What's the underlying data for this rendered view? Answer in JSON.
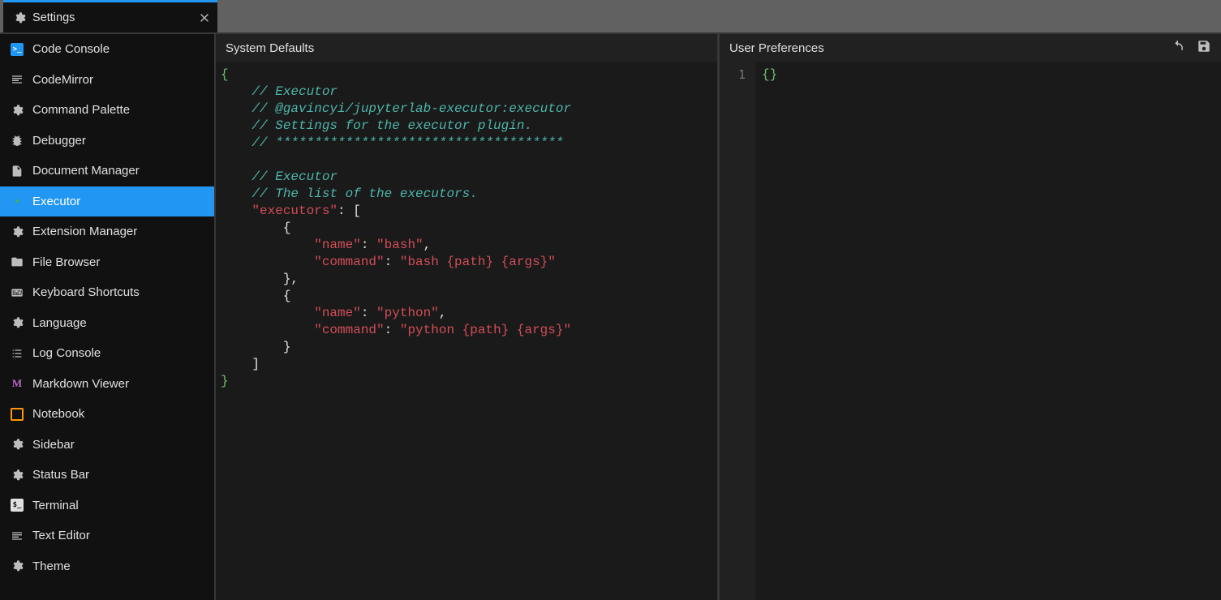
{
  "tab": {
    "title": "Settings"
  },
  "sidebar": {
    "items": [
      {
        "label": "Code Console",
        "icon": "console-icon",
        "selected": false
      },
      {
        "label": "CodeMirror",
        "icon": "lines-icon",
        "selected": false
      },
      {
        "label": "Command Palette",
        "icon": "gear-icon",
        "selected": false
      },
      {
        "label": "Debugger",
        "icon": "bug-icon",
        "selected": false
      },
      {
        "label": "Document Manager",
        "icon": "file-icon",
        "selected": false
      },
      {
        "label": "Executor",
        "icon": "play-icon",
        "selected": true
      },
      {
        "label": "Extension Manager",
        "icon": "gear-icon",
        "selected": false
      },
      {
        "label": "File Browser",
        "icon": "folder-icon",
        "selected": false
      },
      {
        "label": "Keyboard Shortcuts",
        "icon": "keyboard-icon",
        "selected": false
      },
      {
        "label": "Language",
        "icon": "gear-icon",
        "selected": false
      },
      {
        "label": "Log Console",
        "icon": "list-icon",
        "selected": false
      },
      {
        "label": "Markdown Viewer",
        "icon": "markdown-icon",
        "selected": false
      },
      {
        "label": "Notebook",
        "icon": "notebook-icon",
        "selected": false
      },
      {
        "label": "Sidebar",
        "icon": "gear-icon",
        "selected": false
      },
      {
        "label": "Status Bar",
        "icon": "gear-icon",
        "selected": false
      },
      {
        "label": "Terminal",
        "icon": "terminal-icon",
        "selected": false
      },
      {
        "label": "Text Editor",
        "icon": "lines-icon",
        "selected": false
      },
      {
        "label": "Theme",
        "icon": "gear-icon",
        "selected": false
      }
    ]
  },
  "system_defaults": {
    "title": "System Defaults",
    "lines": [
      {
        "t": "brace",
        "text": "{"
      },
      {
        "t": "comment",
        "indent": 1,
        "text": "// Executor"
      },
      {
        "t": "comment",
        "indent": 1,
        "text": "// @gavincyi/jupyterlab-executor:executor"
      },
      {
        "t": "comment",
        "indent": 1,
        "text": "// Settings for the executor plugin."
      },
      {
        "t": "comment",
        "indent": 1,
        "text": "// *************************************"
      },
      {
        "t": "blank"
      },
      {
        "t": "comment",
        "indent": 1,
        "text": "// Executor"
      },
      {
        "t": "comment",
        "indent": 1,
        "text": "// The list of the executors."
      },
      {
        "t": "kv-open-arr",
        "indent": 1,
        "key": "\"executors\""
      },
      {
        "t": "punct",
        "indent": 2,
        "text": "{"
      },
      {
        "t": "kv",
        "indent": 3,
        "key": "\"name\"",
        "val": "\"bash\"",
        "comma": true
      },
      {
        "t": "kv",
        "indent": 3,
        "key": "\"command\"",
        "val": "\"bash {path} {args}\"",
        "comma": false
      },
      {
        "t": "punct",
        "indent": 2,
        "text": "},"
      },
      {
        "t": "punct",
        "indent": 2,
        "text": "{"
      },
      {
        "t": "kv",
        "indent": 3,
        "key": "\"name\"",
        "val": "\"python\"",
        "comma": true
      },
      {
        "t": "kv",
        "indent": 3,
        "key": "\"command\"",
        "val": "\"python {path} {args}\"",
        "comma": false
      },
      {
        "t": "punct",
        "indent": 2,
        "text": "}"
      },
      {
        "t": "punct",
        "indent": 1,
        "text": "]"
      },
      {
        "t": "brace",
        "text": "}"
      }
    ]
  },
  "user_prefs": {
    "title": "User Preferences",
    "gutter_start": 1,
    "content": "{}"
  }
}
